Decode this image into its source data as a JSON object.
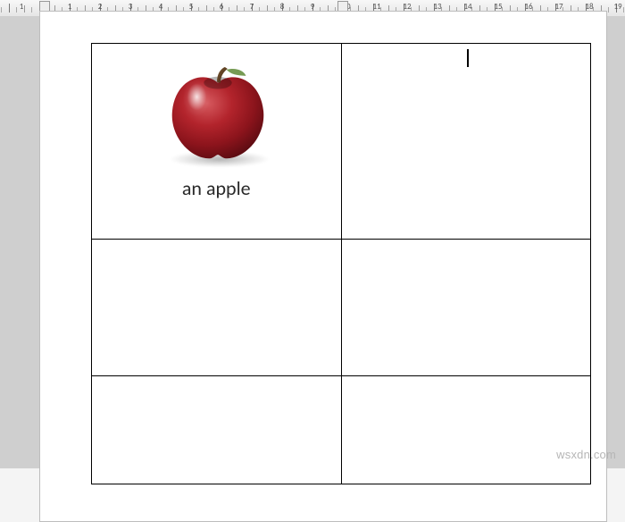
{
  "ruler": {
    "numbers": [
      "1",
      "1",
      "2",
      "3",
      "4",
      "5",
      "6",
      "7",
      "8",
      "9",
      "10",
      "11",
      "12",
      "13",
      "14",
      "15",
      "16",
      "17",
      "18",
      "19"
    ],
    "indent_left_label": "left-indent",
    "indent_right_label": "column-indent"
  },
  "document": {
    "cells": {
      "r1c1_caption": "an apple",
      "r1c2_text": "",
      "cursor_in": "r1c2"
    },
    "image": {
      "name": "apple-image",
      "colors": {
        "skin_main": "#a51820",
        "skin_dark": "#6a0e14",
        "skin_light": "#d65a5f",
        "highlight": "#ffe7e7",
        "stem": "#57381f",
        "leaf": "#5e8a36"
      },
      "alt": "red apple"
    }
  },
  "watermark": "wsxdn.com"
}
